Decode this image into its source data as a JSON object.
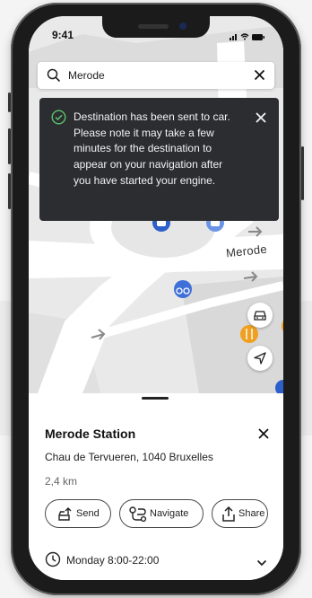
{
  "status": {
    "time": "9:41"
  },
  "search": {
    "query": "Merode"
  },
  "toast": {
    "message": "Destination has been sent to car. Please note it may take a few minutes for the destination to appear on your navigation after you have started your engine."
  },
  "map": {
    "street_label": "Merode"
  },
  "place": {
    "name": "Merode Station",
    "address": "Chau de Tervueren, 1040 Bruxelles",
    "distance": "2,4 km",
    "hours": "Monday 8:00-22:00"
  },
  "actions": {
    "send": "Send",
    "navigate": "Navigate",
    "share": "Share"
  },
  "colors": {
    "toast_bg": "#2b2d30",
    "success_green": "#5cc26e",
    "bike_blue": "#3f6fd8",
    "metro_blue": "#2c5fc9",
    "food_orange": "#f0a020"
  }
}
